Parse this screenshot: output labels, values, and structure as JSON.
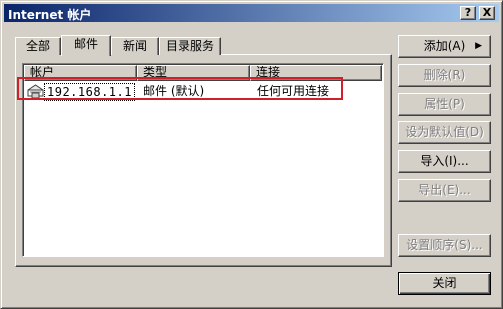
{
  "window": {
    "title": "Internet 帐户",
    "help_button": "?",
    "close_button": "X"
  },
  "tabs": [
    {
      "label": "全部"
    },
    {
      "label": "邮件"
    },
    {
      "label": "新闻"
    },
    {
      "label": "目录服务"
    }
  ],
  "list": {
    "columns": [
      "帐户",
      "类型",
      "连接"
    ],
    "rows": [
      {
        "account": "192.168.1.1",
        "type": "邮件 (默认)",
        "connection": "任何可用连接",
        "icon": "mail-account-icon"
      }
    ]
  },
  "buttons": {
    "add": "添加(A)",
    "add_arrow": "▶",
    "remove": "删除(R)",
    "properties": "属性(P)",
    "set_default": "设为默认值(D)",
    "import": "导入(I)...",
    "export": "导出(E)...",
    "set_order": "设置顺序(S)...",
    "close": "关闭"
  },
  "colors": {
    "highlight_border": "#d0202a",
    "titlebar_start": "#0a246a",
    "titlebar_end": "#a6caf0"
  }
}
